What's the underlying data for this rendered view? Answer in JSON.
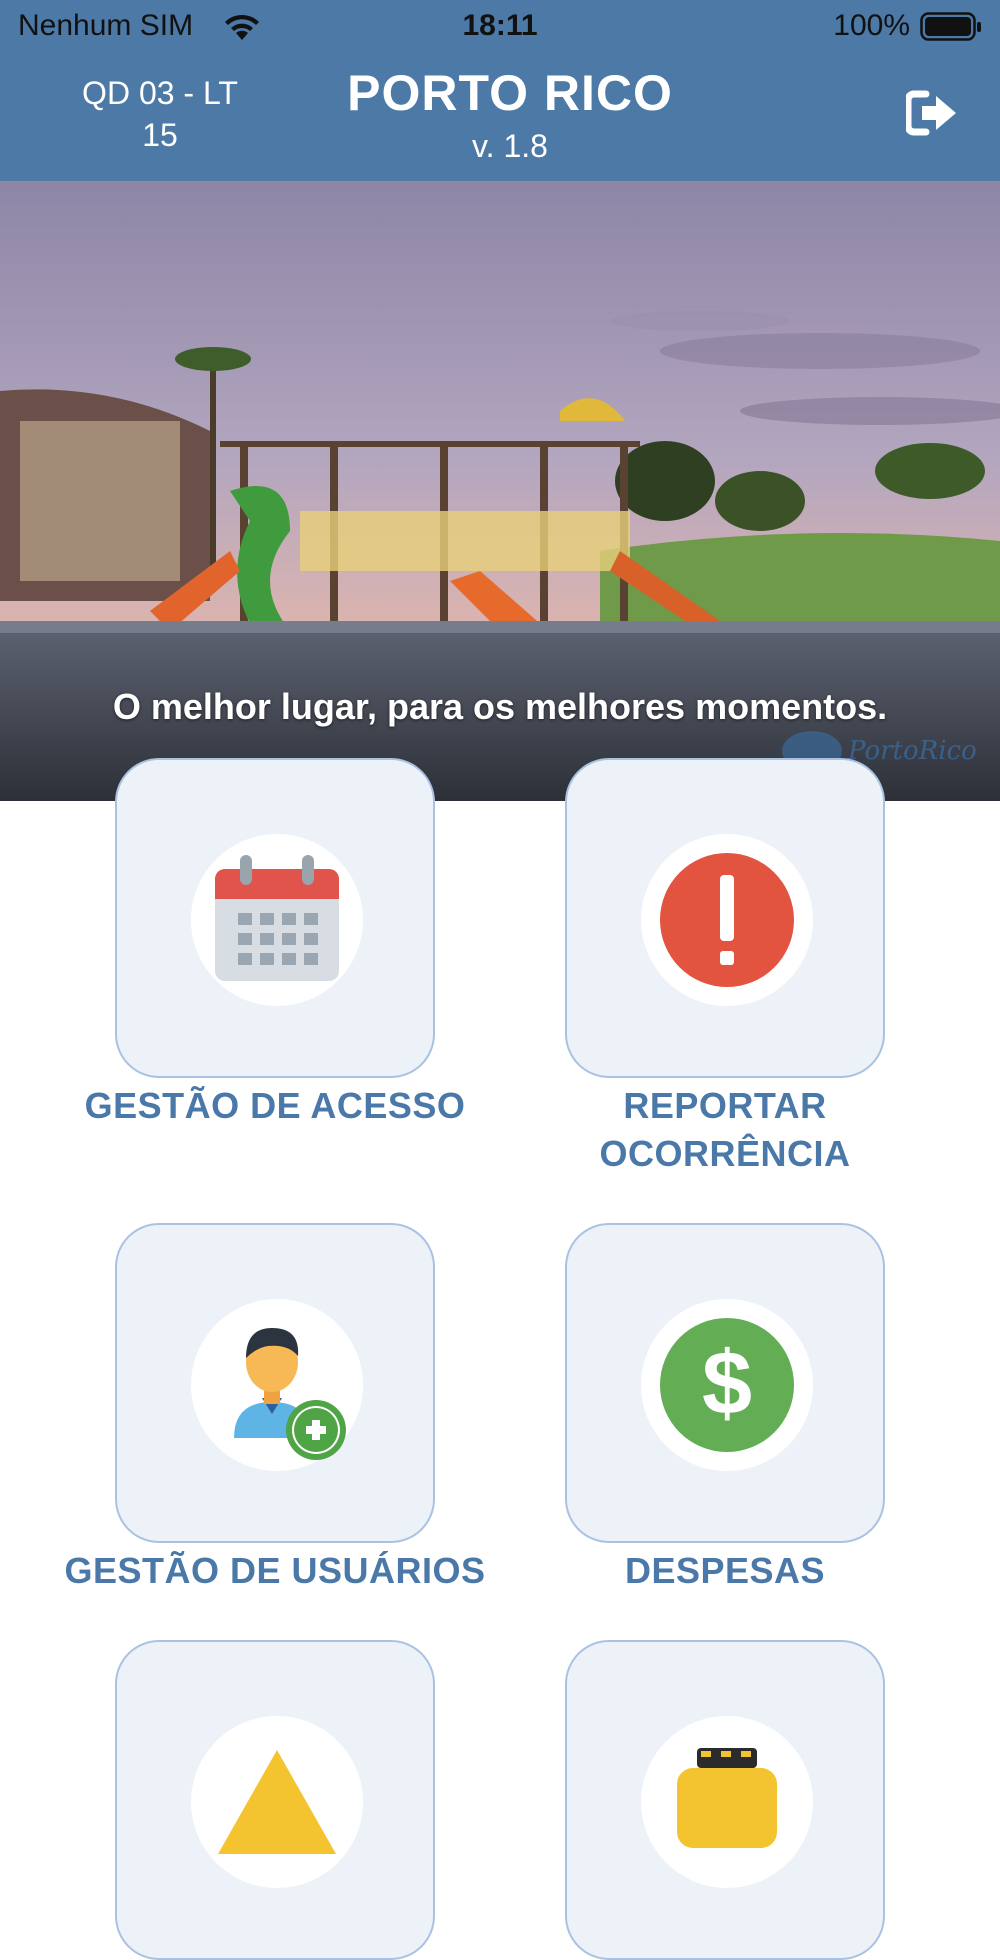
{
  "status_bar": {
    "carrier": "Nenhum SIM",
    "time": "18:11",
    "battery": "100%"
  },
  "header": {
    "lot_line1": "QD 03 - LT",
    "lot_line2": "15",
    "title": "PORTO RICO",
    "version": "v. 1.8",
    "logout_icon": "sign-out-icon"
  },
  "hero": {
    "tagline": "O melhor lugar, para os melhores momentos.",
    "logo_text": "PortoRico"
  },
  "menu": [
    {
      "label": "GESTÃO DE ACESSO",
      "icon": "calendar-icon"
    },
    {
      "label_line1": "REPORTAR",
      "label_line2": "OCORRÊNCIA",
      "icon": "alert-icon"
    },
    {
      "label": "GESTÃO DE USUÁRIOS",
      "icon": "add-user-icon"
    },
    {
      "label": "DESPESAS",
      "icon": "dollar-icon"
    },
    {
      "label": "",
      "icon": "warning-icon"
    },
    {
      "label": "",
      "icon": "taxi-icon"
    }
  ],
  "colors": {
    "header_bg": "#4c79a6",
    "card_bg": "#edf2f9",
    "card_border": "#aac2e2",
    "label": "#4a78a8",
    "calendar_red": "#e0544c",
    "alert_red": "#e25340",
    "dollar_green": "#63ad55"
  }
}
